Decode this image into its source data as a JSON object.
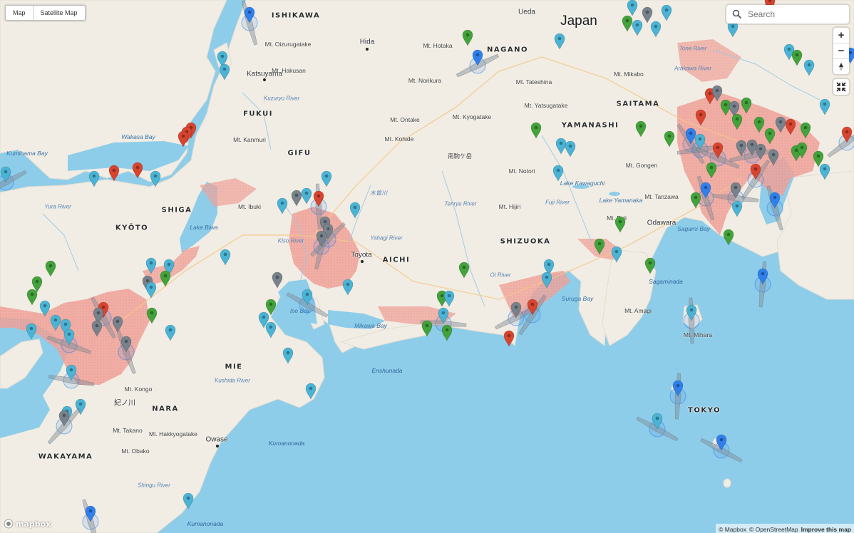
{
  "map_type_toggle": {
    "map_label": "Map",
    "satellite_label": "Satellite Map"
  },
  "search": {
    "placeholder": "Search"
  },
  "zoom_controls": {
    "zoom_in": "+",
    "zoom_out": "−"
  },
  "logo_text": "mapbox",
  "attribution": {
    "mapbox": "© Mapbox",
    "osm": "© OpenStreetMap",
    "improve": "Improve this map"
  },
  "labels": {
    "country": "Japan",
    "regions": [
      "ISHIKAWA",
      "NAGANO",
      "FUKUI",
      "GIFU",
      "YAMANASHI",
      "SAITAMA",
      "KYŌTO",
      "SHIGA",
      "AICHI",
      "SHIZUOKA",
      "MIE",
      "NARA",
      "WAKAYAMA",
      "TOKYO"
    ],
    "cities": [
      "Ueda",
      "Hida",
      "Katsuyama",
      "Toyota",
      "Odawara",
      "Owase",
      "紀ノ川"
    ],
    "mountains": [
      "Mt. Oizurugatake",
      "Mt. Hakusan",
      "Mt. Hotaka",
      "Mt. Norikura",
      "Mt. Tateshina",
      "Mt. Yatsugatake",
      "Mt. Mikabo",
      "Mt. Ontake",
      "Mt. Kohide",
      "Mt. Kyogatake",
      "Mt. Kanmuri",
      "南駒ケ岳",
      "Mt. Notori",
      "Mt. Gongen",
      "Mt. Ibuki",
      "Mt. Hijiri",
      "Mt. Tanzawa",
      "Mt. Fuji",
      "Mt. Amagi",
      "Mt. Mihara",
      "Mt. Kongo",
      "Mt. Takano",
      "Mt. Hakkyogatake",
      "Mt. Obako"
    ],
    "water": [
      "Wakasa Bay",
      "Kumihama Bay",
      "Lake Biwa",
      "Ise Bay",
      "Mikawa Bay",
      "Suruga Bay",
      "Sagami Bay",
      "Lake Kawaguchi",
      "Lake Yamanaka",
      "Enshunada",
      "Kumanonada",
      "Sagaminada"
    ],
    "rivers": [
      "Kuzuryu River",
      "Yura River",
      "Kiso River",
      "Yahagi River",
      "Tenryu River",
      "Oi River",
      "Fuji River",
      "Arakawa River",
      "Tone River",
      "Kushida River",
      "Shingu River",
      "木曽川"
    ]
  },
  "marker_colors": {
    "cyan": "#4ab4d6",
    "blue": "#2f80ed",
    "red": "#d9442f",
    "green": "#42a33a",
    "gray": "#77828c"
  },
  "marker_counts": {
    "cyan": 58,
    "blue": 12,
    "red": 20,
    "green": 34,
    "gray": 36
  }
}
